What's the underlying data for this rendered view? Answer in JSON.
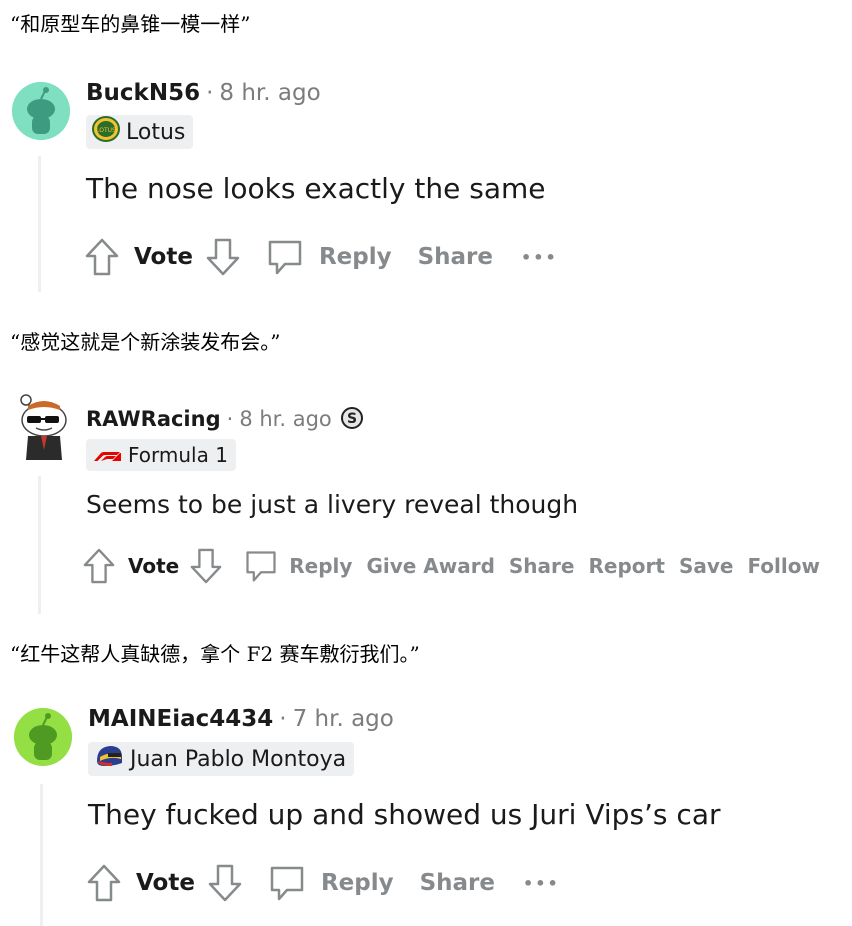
{
  "captions": [
    "“和原型车的鼻锥一模一样”",
    "“感觉这就是个新涂装发布会。”",
    "“红牛这帮人真缺德，拿个 F2 赛车敷衍我们。”"
  ],
  "comments": [
    {
      "username": "BuckN56",
      "separator": "·",
      "time": "8 hr. ago",
      "flair": "Lotus",
      "flair_icon": "lotus-badge-icon",
      "text": "The nose looks exactly the same",
      "avatar_color": "#7ee0c0",
      "actions": {
        "vote": "Vote",
        "reply": "Reply",
        "share": "Share",
        "more": "•••"
      }
    },
    {
      "username": "RAWRacing",
      "separator": "·",
      "time": "8 hr. ago",
      "flair": "Formula 1",
      "flair_icon": "f1-logo-icon",
      "badge_icon": "award-s-icon",
      "text": "Seems to be just a livery reveal though",
      "actions": {
        "vote": "Vote",
        "reply": "Reply",
        "give_award": "Give Award",
        "share": "Share",
        "report": "Report",
        "save": "Save",
        "follow": "Follow"
      }
    },
    {
      "username": "MAINEiac4434",
      "separator": "·",
      "time": "7 hr. ago",
      "flair": "Juan Pablo Montoya",
      "flair_icon": "helmet-icon",
      "text": "They fucked up and showed us Juri Vips’s car",
      "avatar_color": "#94e044",
      "actions": {
        "vote": "Vote",
        "reply": "Reply",
        "share": "Share",
        "more": "•••"
      }
    }
  ],
  "colors": {
    "text": "#1a1a1b",
    "muted": "#878a8c",
    "flair_bg": "#edeff1",
    "thread_line": "#edeff1",
    "f1_red": "#e10600"
  }
}
